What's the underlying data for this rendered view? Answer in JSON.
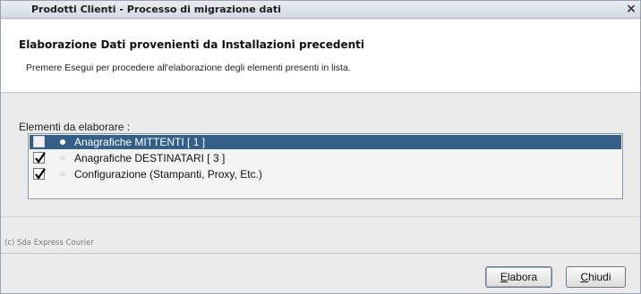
{
  "window": {
    "title": "Prodotti Clienti - Processo di migrazione dati",
    "close_symbol": "×"
  },
  "header": {
    "heading": "Elaborazione Dati provenienti da Installazioni precedenti",
    "description": "Premere Esegui per procedere all'elaborazione degli elementi presenti in lista."
  },
  "section": {
    "label": "Elementi da elaborare :"
  },
  "items": [
    {
      "label": "Anagrafiche MITTENTI  [ 1 ]",
      "checked": false,
      "selected": true
    },
    {
      "label": "Anagrafiche DESTINATARI  [ 3 ]",
      "checked": true,
      "selected": false
    },
    {
      "label": "Configurazione (Stampanti, Proxy, Etc.)",
      "checked": true,
      "selected": false
    }
  ],
  "footer": {
    "copyright": "(c) Sda Express Courier"
  },
  "buttons": {
    "elabora": {
      "mnemonic": "E",
      "rest": "labora"
    },
    "chiudi": {
      "mnemonic": "C",
      "rest": "hiudi"
    }
  }
}
